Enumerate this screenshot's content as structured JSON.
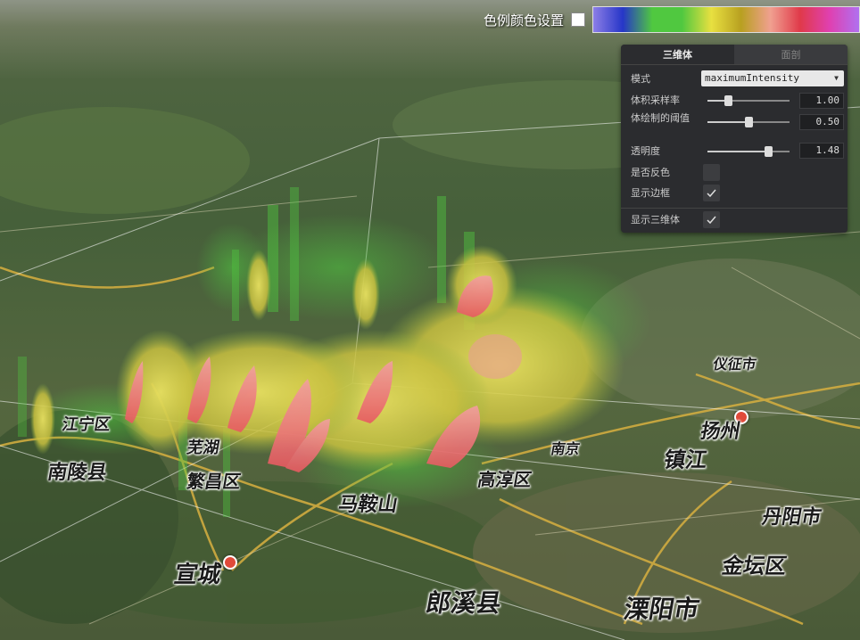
{
  "colorbar": {
    "label": "色例颜色设置",
    "checked": false,
    "gradient_colors": [
      "#8c7ee6",
      "#2636c8",
      "#50c840",
      "#50c840",
      "#e8e040",
      "#b8a020",
      "#f0a090",
      "#e03a4a",
      "#e040b0",
      "#b070f0"
    ]
  },
  "panel": {
    "tabs": [
      {
        "label": "三维体",
        "active": true
      },
      {
        "label": "面剖",
        "active": false
      }
    ],
    "mode": {
      "label": "模式",
      "value": "maximumIntensity"
    },
    "sampling": {
      "label": "体积采样率",
      "value": "1.00",
      "fraction": 0.25
    },
    "threshold": {
      "label": "体绘制的阈值",
      "value": "0.50",
      "fraction": 0.5
    },
    "opacity": {
      "label": "透明度",
      "value": "1.48",
      "fraction": 0.74
    },
    "invert": {
      "label": "是否反色",
      "checked": false
    },
    "show_border": {
      "label": "显示边框",
      "checked": true
    },
    "show_volume": {
      "label": "显示三维体",
      "checked": true
    }
  },
  "map_labels": [
    {
      "text": "扬州",
      "name": "label-yangzhou"
    },
    {
      "text": "镇江",
      "name": "label-zhenjiang"
    },
    {
      "text": "丹阳市",
      "name": "label-danyang"
    },
    {
      "text": "金坛区",
      "name": "label-jintan"
    },
    {
      "text": "溧阳市",
      "name": "label-liyang"
    },
    {
      "text": "郎溪县",
      "name": "label-langxi"
    },
    {
      "text": "宣城",
      "name": "label-xuancheng"
    },
    {
      "text": "南陵县",
      "name": "label-nanling"
    },
    {
      "text": "南京",
      "name": "label-nanjing"
    },
    {
      "text": "高淳区",
      "name": "label-gaochun"
    },
    {
      "text": "仪征市",
      "name": "label-yizheng"
    },
    {
      "text": "芜湖",
      "name": "label-wuhu"
    },
    {
      "text": "繁昌区",
      "name": "label-fanchang"
    },
    {
      "text": "马鞍山",
      "name": "label-maanshan"
    },
    {
      "text": "江宁区",
      "name": "label-jiangning"
    }
  ]
}
